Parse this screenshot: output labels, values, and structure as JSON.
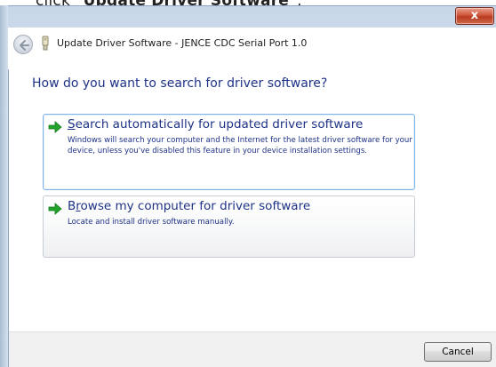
{
  "instruction": {
    "prefix": "click ",
    "quoted": "\"Update Driver Software\"",
    "suffix": "."
  },
  "window": {
    "title": "Update Driver Software - JENCE CDC Serial Port 1.0",
    "close_label": "x",
    "close_color": "#c7462b"
  },
  "main": {
    "heading": "How do you want to search for driver software?",
    "options": [
      {
        "title_mnemonic": "S",
        "title_rest": "earch automatically for updated driver software",
        "description": "Windows will search your computer and the Internet for the latest driver software for your device, unless you've disabled this feature in your device installation settings.",
        "icon": "green-arrow-icon"
      },
      {
        "title_first": "B",
        "title_mnemonic": "r",
        "title_rest": "owse my computer for driver software",
        "description": "Locate and install driver software manually.",
        "icon": "green-arrow-icon"
      }
    ]
  },
  "footer": {
    "cancel_label": "Cancel"
  },
  "colors": {
    "link_text": "#1e3287",
    "arrow_green": "#22a52a",
    "selected_border": "#7eb4ea"
  }
}
